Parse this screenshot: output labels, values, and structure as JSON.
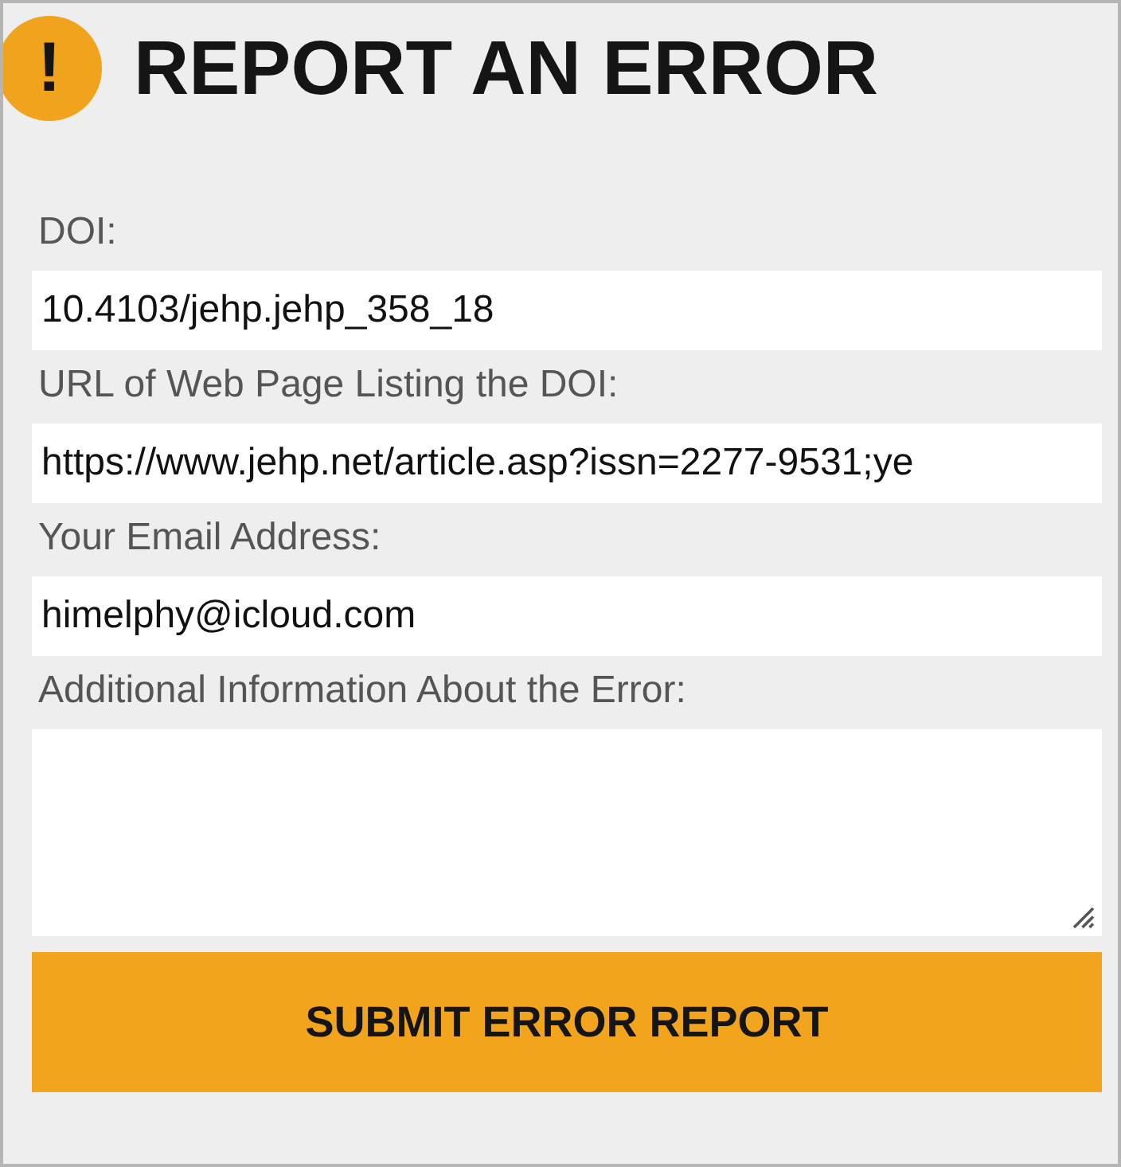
{
  "header": {
    "badge": "!",
    "title": "REPORT AN ERROR"
  },
  "fields": [
    {
      "kind": "input",
      "label": "DOI:",
      "value": "10.4103/jehp.jehp_358_18"
    },
    {
      "kind": "input",
      "label": "URL of Web Page Listing the DOI:",
      "value": "https://www.jehp.net/article.asp?issn=2277-9531;ye"
    },
    {
      "kind": "input",
      "label": "Your Email Address:",
      "value": "himelphy@icloud.com"
    },
    {
      "kind": "textarea",
      "label": "Additional Information About the Error:"
    }
  ],
  "submit": {
    "label": "SUBMIT ERROR REPORT"
  }
}
